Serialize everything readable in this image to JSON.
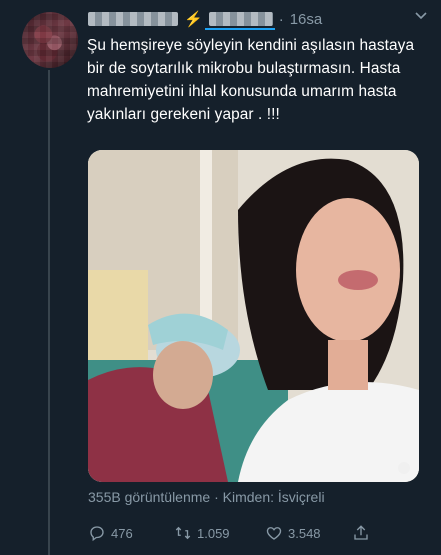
{
  "tweet": {
    "timestamp": "16sa",
    "text": "Şu hemşireye söyleyin kendini aşılasın hastaya bir de soytarılık mikrobu bulaştırmasın. Hasta mahremiyetini ihlal konusunda umarım hasta yakınları gerekeni yapar . !!!",
    "stats": "355B görüntülenme · Kimden: İsviçreli"
  },
  "actions": {
    "reply_count": "476",
    "retweet_count": "1.059",
    "like_count": "3.548"
  },
  "icons": {
    "verified_like": "lightning-bolt-icon",
    "menu": "chevron-down-icon",
    "reply": "reply-icon",
    "retweet": "retweet-icon",
    "like": "heart-icon",
    "share": "share-icon"
  },
  "colors": {
    "background": "#15202b",
    "secondary_text": "#8899a6",
    "accent": "#1da1f2"
  }
}
